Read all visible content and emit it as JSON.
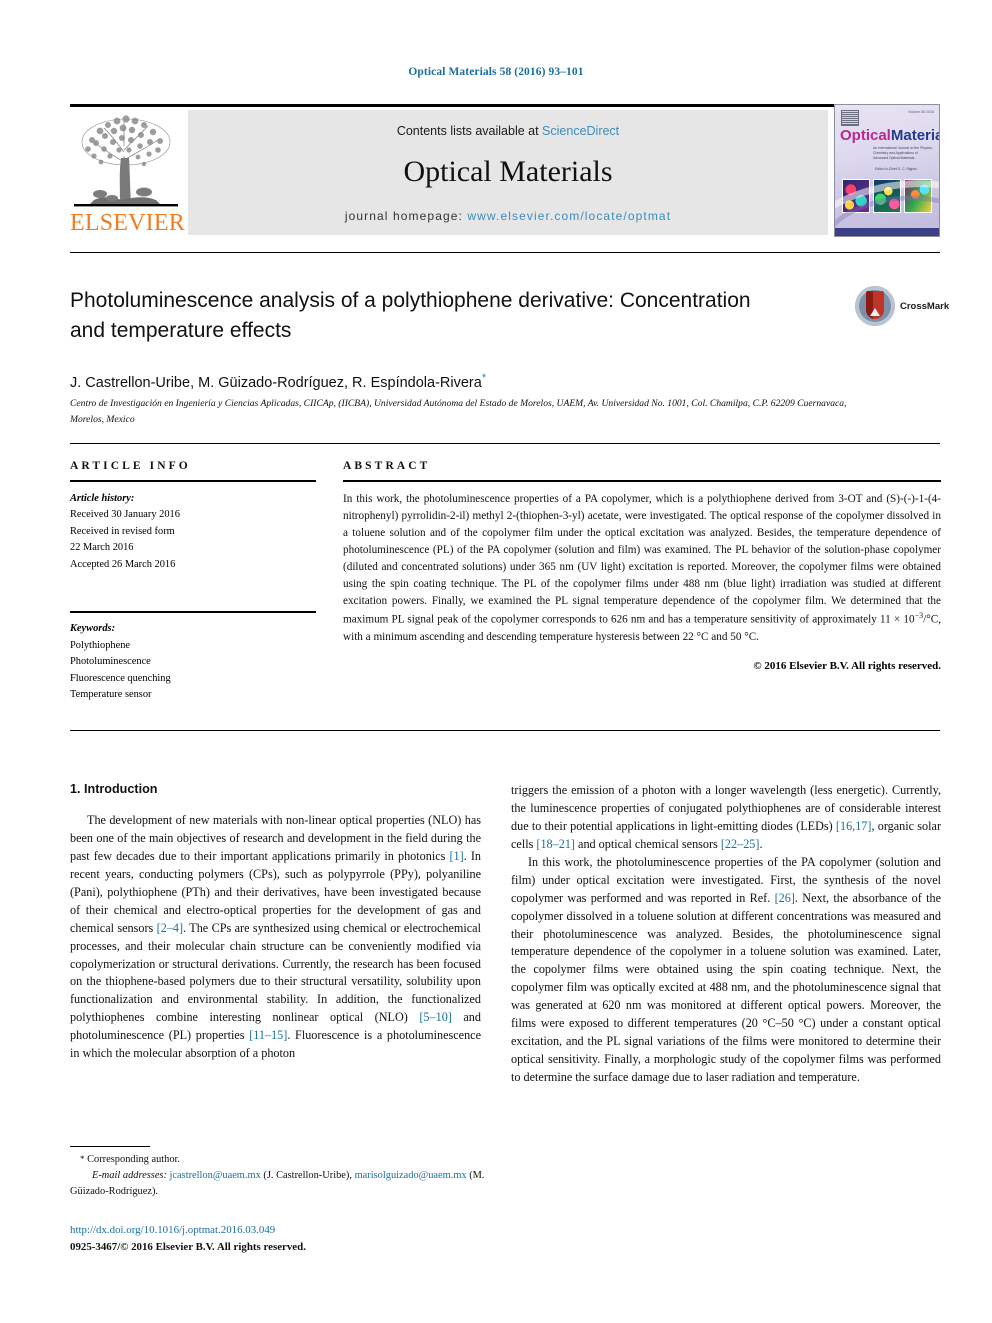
{
  "running_head": "Optical Materials 58 (2016) 93–101",
  "masthead": {
    "publisher_name": "ELSEVIER",
    "contents_prefix": "Contents lists available at ",
    "contents_link": "ScienceDirect",
    "journal_title": "Optical Materials",
    "homepage_prefix": "journal homepage: ",
    "homepage_url": "www.elsevier.com/locate/optmat",
    "cover": {
      "title_a": "Optical",
      "title_b": "Materials",
      "subtitle": "An International Journal on the Physics, Chemistry and Applications of Advanced Optical Materials",
      "editors": "Editor-in-Chief\nG. C. Righini",
      "issue": "Volume 58  2016"
    },
    "accent_link_color": "#3c8dbc"
  },
  "article": {
    "title": "Photoluminescence analysis of a polythiophene derivative: Concentration and temperature effects",
    "crossmark_label": "CrossMark",
    "authors": "J. Castrellon-Uribe, M. Güizado-Rodríguez, R. Espíndola-Rivera",
    "author_star": "*",
    "affiliation": "Centro de Investigación en Ingeniería y Ciencias Aplicadas, CIICAp, (IICBA), Universidad Autónoma del Estado de Morelos, UAEM, Av. Universidad No. 1001, Col. Chamilpa, C.P. 62209 Cuernavaca, Morelos, Mexico"
  },
  "info": {
    "heading": "ARTICLE INFO",
    "history_label": "Article history:",
    "history_lines": "Received 30 January 2016\nReceived in revised form\n22 March 2016\nAccepted 26 March 2016",
    "keywords_label": "Keywords:",
    "keywords": "Polythiophene\nPhotoluminescence\nFluorescence quenching\nTemperature sensor"
  },
  "abstract": {
    "heading": "ABSTRACT",
    "text": "In this work, the photoluminescence properties of a PA copolymer, which is a polythiophene derived from 3-OT and (S)-(-)-1-(4-nitrophenyl) pyrrolidin-2-il) methyl 2-(thiophen-3-yl) acetate, were investigated. The optical response of the copolymer dissolved in a toluene solution and of the copolymer film under the optical excitation was analyzed. Besides, the temperature dependence of photoluminescence (PL) of the PA copolymer (solution and film) was examined. The PL behavior of the solution-phase copolymer (diluted and concentrated solutions) under 365 nm (UV light) excitation is reported. Moreover, the copolymer films were obtained using the spin coating technique. The PL of the copolymer films under 488 nm (blue light) irradiation was studied at different excitation powers. Finally, we examined the PL signal temperature dependence of the copolymer film. We determined that the maximum PL signal peak of the copolymer corresponds to 626 nm and has a temperature sensitivity of approximately 11 × 10",
    "sensitivity_exp": "−3",
    "text_tail": "/°C, with a minimum ascending and descending temperature hysteresis between 22 °C and 50 °C.",
    "rights": "© 2016 Elsevier B.V. All rights reserved."
  },
  "body": {
    "section_heading": "1. Introduction",
    "left_p1_a": "The development of new materials with non-linear optical properties (NLO) has been one of the main objectives of research and development in the field during the past few decades due to their important applications primarily in photonics ",
    "ref1": "[1]",
    "left_p1_b": ". In recent years, conducting polymers (CPs), such as polypyrrole (PPy), polyaniline (Pani), polythiophene (PTh) and their derivatives, have been investigated because of their chemical and electro-optical properties for the development of gas and chemical sensors ",
    "ref2": "[2–4]",
    "left_p1_c": ". The CPs are synthesized using chemical or electrochemical processes, and their molecular chain structure can be conveniently modified via copolymerization or structural derivations. Currently, the research has been focused on the thiophene-based polymers due to their structural versatility, solubility upon functionalization and environmental stability. In addition, the functionalized polythiophenes combine interesting nonlinear optical (NLO) ",
    "ref3": "[5–10]",
    "left_p1_d": " and photoluminescence (PL) properties ",
    "ref4": "[11–15]",
    "left_p1_e": ". Fluorescence is a photoluminescence in which the molecular absorption of a photon",
    "right_p1_a": "triggers the emission of a photon with a longer wavelength (less energetic). Currently, the luminescence properties of conjugated polythiophenes are of considerable interest due to their potential applications in light-emitting diodes (LEDs) ",
    "ref5": "[16,17]",
    "right_p1_b": ", organic solar cells ",
    "ref6": "[18–21]",
    "right_p1_c": " and optical chemical sensors ",
    "ref7": "[22–25]",
    "right_p1_d": ".",
    "right_p2_a": "In this work, the photoluminescence properties of the PA copolymer (solution and film) under optical excitation were investigated. First, the synthesis of the novel copolymer was performed and was reported in Ref. ",
    "ref8": "[26]",
    "right_p2_b": ". Next, the absorbance of the copolymer dissolved in a toluene solution at different concentrations was measured and their photoluminescence was analyzed. Besides, the photoluminescence signal temperature dependence of the copolymer in a toluene solution was examined. Later, the copolymer films were obtained using the spin coating technique. Next, the copolymer film was optically excited at 488 nm, and the photoluminescence signal that was generated at 620 nm was monitored at different optical powers. Moreover, the films were exposed to different temperatures (20 °C–50 °C) under a constant optical excitation, and the PL signal variations of the films were monitored to determine their optical sensitivity. Finally, a morphologic study of the copolymer films was performed to determine the surface damage due to laser radiation and temperature."
  },
  "footer": {
    "corresponding_marker": "*",
    "corresponding_label": " Corresponding author.",
    "email_label": "E-mail addresses:",
    "email1": "jcastrellon@uaem.mx",
    "email1_owner": "(J. Castrellon-Uribe),",
    "email2": "marisolguizado@uaem.mx",
    "email2_owner": "(M. Güizado-Rodríguez).",
    "doi": "http://dx.doi.org/10.1016/j.optmat.2016.03.049",
    "issn_line": "0925-3467/© 2016 Elsevier B.V. All rights reserved."
  }
}
